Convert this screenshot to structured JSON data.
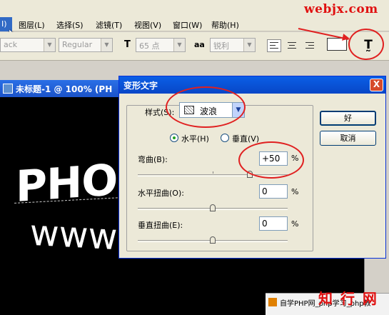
{
  "watermarks": {
    "top": "webjx.com",
    "bottom": "知 行 网"
  },
  "menubar": {
    "selected_stub": "I)",
    "items": [
      {
        "label": "图层(L)"
      },
      {
        "label": "选择(S)"
      },
      {
        "label": "滤镜(T)"
      },
      {
        "label": "视图(V)"
      },
      {
        "label": "窗口(W)"
      },
      {
        "label": "帮助(H)"
      }
    ]
  },
  "options_bar": {
    "font_family": "ack",
    "font_style": "Regular",
    "font_size": "65 点",
    "font_size_icon": "T",
    "antialias_icon": "aa",
    "antialias": "锐利",
    "warp_icon": "T̰"
  },
  "document": {
    "title": "未标题-1 @ 100% (PH",
    "text_line1": "PHO",
    "text_line2": "www"
  },
  "bottom_banner": {
    "text": "自学PHP网_php学习_php教"
  },
  "dialog": {
    "title": "变形文字",
    "close": "X",
    "style_label": "样式(S):",
    "style_value": "波浪",
    "horizontal_label": "水平(H)",
    "vertical_label": "垂直(V)",
    "bend_label": "弯曲(B):",
    "bend_value": "+50",
    "h_distort_label": "水平扭曲(O):",
    "h_distort_value": "0",
    "v_distort_label": "垂直扭曲(E):",
    "v_distort_value": "0",
    "percent": "%",
    "ok_label": "好",
    "cancel_label": "取消",
    "dropdown_arrow": "▼"
  }
}
